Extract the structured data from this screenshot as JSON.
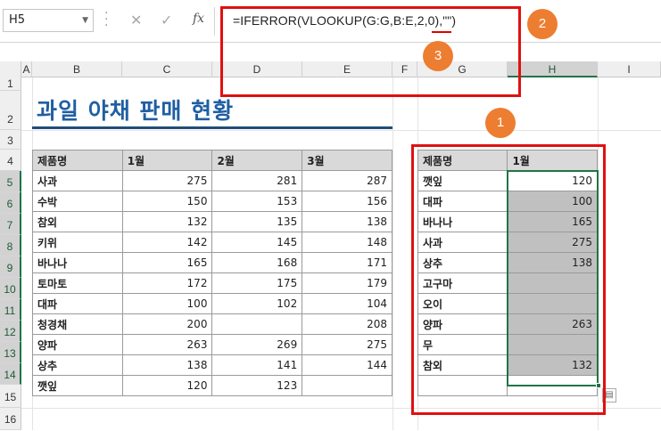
{
  "formula_bar": {
    "name_box": "H5",
    "cancel_glyph": "✕",
    "enter_glyph": "✓",
    "fx_label": "fx",
    "formula": "=IFERROR(VLOOKUP(G:G,B:E,2,0),\"\")"
  },
  "columns": [
    "A",
    "B",
    "C",
    "D",
    "E",
    "F",
    "G",
    "H",
    "I"
  ],
  "rows": [
    "1",
    "2",
    "3",
    "4",
    "5",
    "6",
    "7",
    "8",
    "9",
    "10",
    "11",
    "12",
    "13",
    "14",
    "15",
    "16"
  ],
  "title": "과일 야채 판매 현황",
  "left_table": {
    "headers": [
      "제품명",
      "1월",
      "2월",
      "3월"
    ],
    "rows": [
      [
        "사과",
        "275",
        "281",
        "287"
      ],
      [
        "수박",
        "150",
        "153",
        "156"
      ],
      [
        "참외",
        "132",
        "135",
        "138"
      ],
      [
        "키위",
        "142",
        "145",
        "148"
      ],
      [
        "바나나",
        "165",
        "168",
        "171"
      ],
      [
        "토마토",
        "172",
        "175",
        "179"
      ],
      [
        "대파",
        "100",
        "102",
        "104"
      ],
      [
        "청경채",
        "200",
        "",
        "208"
      ],
      [
        "양파",
        "263",
        "269",
        "275"
      ],
      [
        "상추",
        "138",
        "141",
        "144"
      ],
      [
        "깻잎",
        "120",
        "123",
        ""
      ]
    ]
  },
  "right_table": {
    "headers": [
      "제품명",
      "1월"
    ],
    "rows": [
      [
        "깻잎",
        "120"
      ],
      [
        "대파",
        "100"
      ],
      [
        "바나나",
        "165"
      ],
      [
        "사과",
        "275"
      ],
      [
        "상추",
        "138"
      ],
      [
        "고구마",
        ""
      ],
      [
        "오이",
        ""
      ],
      [
        "양파",
        "263"
      ],
      [
        "무",
        ""
      ],
      [
        "참외",
        "132"
      ],
      [
        "",
        ""
      ]
    ]
  },
  "badges": [
    "1",
    "2",
    "3"
  ],
  "colors": {
    "annotation_red": "#e01010",
    "badge_orange": "#ed7d31",
    "title_blue": "#1f5fa2",
    "excel_green": "#217346"
  }
}
